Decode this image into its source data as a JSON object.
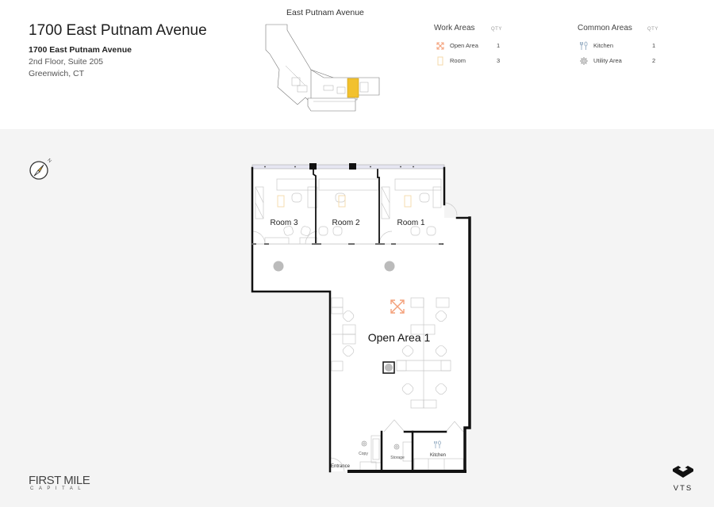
{
  "header": {
    "title": "1700 East Putnam Avenue",
    "address_line1": "1700 East Putnam Avenue",
    "address_line2": "2nd Floor, Suite 205",
    "address_line3": "Greenwich, CT"
  },
  "keyplan": {
    "title": "East Putnam Avenue",
    "highlight_color": "#f2c12e"
  },
  "legend": {
    "work_areas": {
      "heading": "Work Areas",
      "qty_label": "QTY",
      "items": [
        {
          "icon": "open-area-icon",
          "label": "Open Area",
          "qty": "1",
          "color": "#f4a07a"
        },
        {
          "icon": "room-icon",
          "label": "Room",
          "qty": "3",
          "color": "#f6d9a8"
        }
      ]
    },
    "common_areas": {
      "heading": "Common Areas",
      "qty_label": "QTY",
      "items": [
        {
          "icon": "kitchen-icon",
          "label": "Kitchen",
          "qty": "1",
          "color": "#9db3c7"
        },
        {
          "icon": "utility-gear-icon",
          "label": "Utility Area",
          "qty": "2",
          "color": "#999999"
        }
      ]
    }
  },
  "compass": {
    "north_label": "N"
  },
  "floorplan": {
    "rooms": [
      {
        "label": "Room 3"
      },
      {
        "label": "Room 2"
      },
      {
        "label": "Room 1"
      }
    ],
    "open_area_label": "Open Area 1",
    "copy_label": "Copy",
    "storage_label": "Storage",
    "kitchen_label": "Kitchen",
    "entrance_label": "Entrance"
  },
  "branding": {
    "landlord_line1": "FIRST MILE",
    "landlord_line2": "CAPITAL",
    "platform": "VTS"
  }
}
